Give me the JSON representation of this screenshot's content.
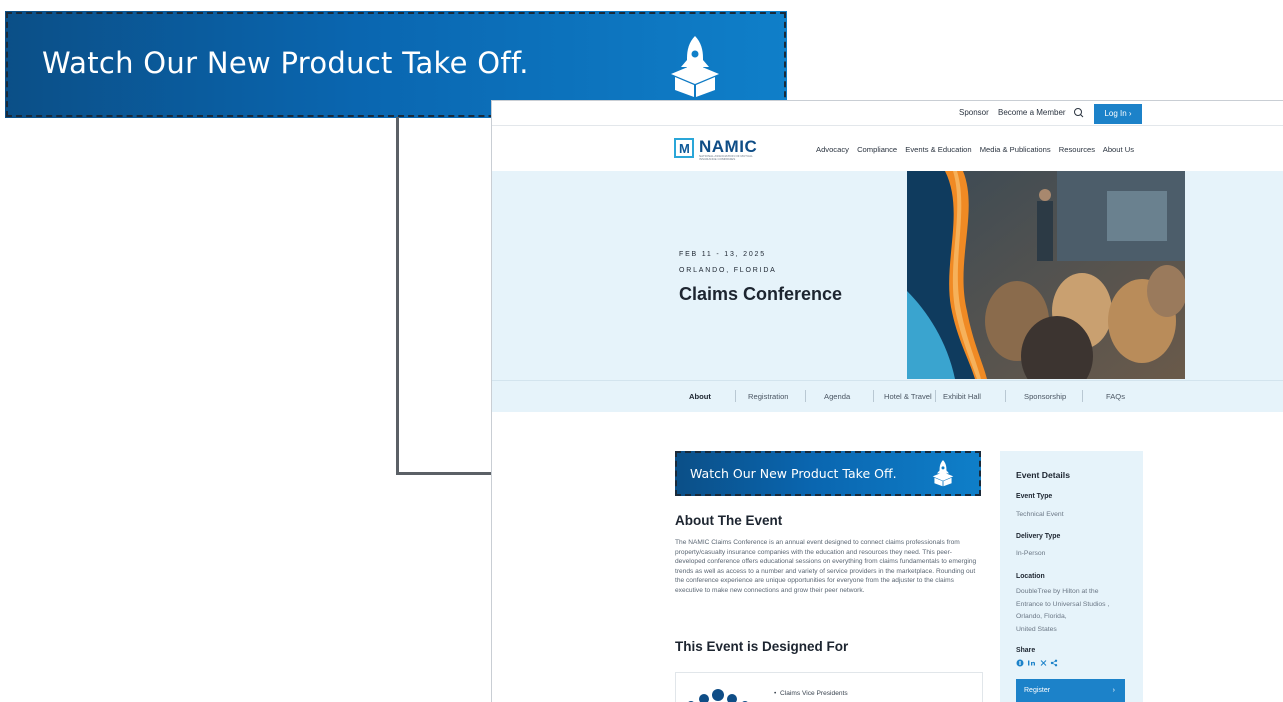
{
  "callout": {
    "text": "Watch Our New Product Take Off.",
    "icon": "rocket-in-box-icon"
  },
  "site": {
    "utility_nav": [
      "Sponsor",
      "Become a Member"
    ],
    "search_icon": "search-icon",
    "login_label": "Log In ›",
    "logo_text": "NAMIC",
    "logo_mark": "M",
    "logo_tagline": "NATIONAL ASSOCIATION OF MUTUAL INSURANCE COMPANIES",
    "main_nav": [
      "Advocacy",
      "Compliance",
      "Events & Education",
      "Media & Publications",
      "Resources",
      "About Us"
    ]
  },
  "hero": {
    "date": "FEB 11 - 13, 2025",
    "location": "ORLANDO, FLORIDA",
    "title": "Claims Conference"
  },
  "subnav": {
    "tabs": [
      "About",
      "Registration",
      "Agenda",
      "Hotel & Travel",
      "Exhibit Hall",
      "Sponsorship",
      "FAQs"
    ],
    "active": "About"
  },
  "about": {
    "heading": "About The Event",
    "body": "The NAMIC Claims Conference is an annual event designed to connect claims professionals from property/casualty insurance companies with the education and resources they need. This peer-developed conference offers educational sessions on everything from claims fundamentals to emerging trends as well as access to a number and variety of service providers in the marketplace. Rounding out the conference experience are unique opportunities for everyone from the adjuster to the claims executive to make new connections and grow their peer network."
  },
  "designed_for": {
    "heading": "This Event is Designed For",
    "items": [
      "Claims Vice Presidents"
    ]
  },
  "event_details": {
    "heading": "Event Details",
    "event_type_label": "Event Type",
    "event_type": "Technical Event",
    "delivery_type_label": "Delivery Type",
    "delivery_type": "In-Person",
    "location_label": "Location",
    "location_line1": "DoubleTree by Hilton at the",
    "location_line2": "Entrance to Universal Studios ,",
    "location_line3": "Orlando, Florida,",
    "location_line4": "United States",
    "share_label": "Share",
    "register_label": "Register",
    "register_arrow": "›"
  },
  "colors": {
    "brand_blue": "#1c82c9",
    "callout_dark": "#0b4f87",
    "hero_bg": "#e6f3fa",
    "accent_orange": "#f08a24"
  }
}
